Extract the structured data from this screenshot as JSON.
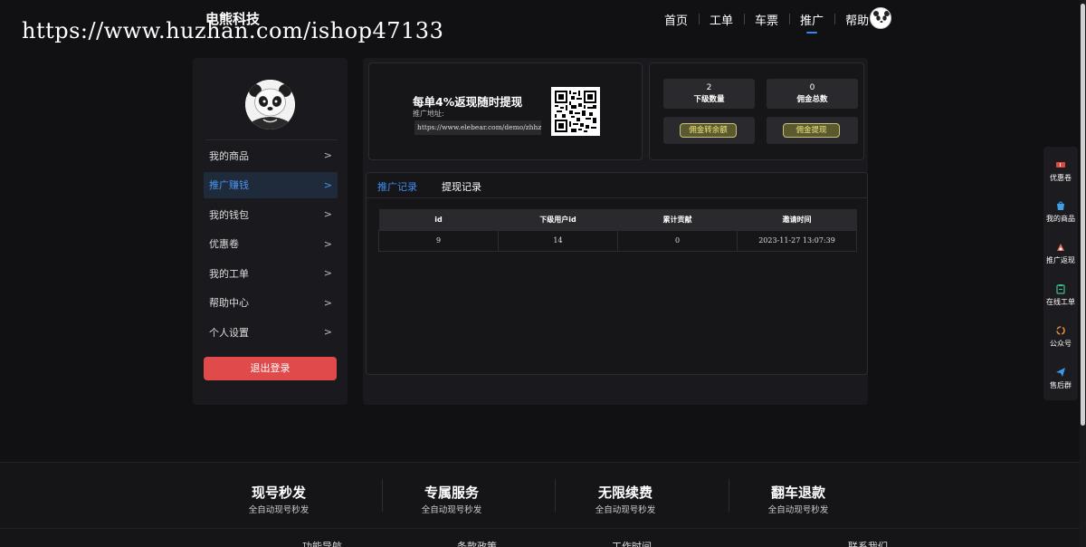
{
  "header": {
    "brand": "电熊科技",
    "watermark_url": "https://www.huzhan.com/ishop47133",
    "nav": [
      "首页",
      "工单",
      "车票",
      "推广",
      "帮助"
    ],
    "active_nav": "推广"
  },
  "sidebar": {
    "items": [
      {
        "label": "我的商品",
        "arrow": ">"
      },
      {
        "label": "推广赚钱",
        "arrow": ">"
      },
      {
        "label": "我的钱包",
        "arrow": ">"
      },
      {
        "label": "优惠卷",
        "arrow": ">"
      },
      {
        "label": "我的工单",
        "arrow": ">"
      },
      {
        "label": "帮助中心",
        "arrow": ">"
      },
      {
        "label": "个人设置",
        "arrow": ">"
      }
    ],
    "active_item": "推广赚钱",
    "logout_label": "退出登录"
  },
  "promo": {
    "title": "每单4%返现随时提现",
    "address_label": "推广地址:",
    "url": "https://www.elebear.com/demo/zhhz?uid=1"
  },
  "stats": {
    "downline_count": "2",
    "downline_label": "下级数量",
    "commission_total": "0",
    "commission_label": "佣金总数",
    "to_balance_button": "佣金转余额",
    "withdraw_button": "佣金提现"
  },
  "records": {
    "tabs": [
      "推广记录",
      "提现记录"
    ],
    "active_tab": "推广记录",
    "columns": [
      "id",
      "下级用户id",
      "累计贡献",
      "邀请时间"
    ],
    "rows": [
      [
        "9",
        "14",
        "0",
        "2023-11-27 13:07:39"
      ]
    ]
  },
  "float_sidebar": {
    "items": [
      {
        "label": "优惠卷",
        "icon": "coupon-icon",
        "color": "#e0473f"
      },
      {
        "label": "我的商品",
        "icon": "bag-icon",
        "color": "#3fa0e8"
      },
      {
        "label": "推广返现",
        "icon": "share-icon",
        "color": "#e06a5a"
      },
      {
        "label": "在线工单",
        "icon": "clipboard-icon",
        "color": "#3dbf8a"
      },
      {
        "label": "公众号",
        "icon": "wechat-icon",
        "color": "#e08a3a"
      },
      {
        "label": "售后群",
        "icon": "send-icon",
        "color": "#3a9ae8"
      }
    ]
  },
  "footer": {
    "features": [
      {
        "title": "现号秒发",
        "subtitle": "全自动现号秒发"
      },
      {
        "title": "专属服务",
        "subtitle": "全自动现号秒发"
      },
      {
        "title": "无限续费",
        "subtitle": "全自动现号秒发"
      },
      {
        "title": "翻车退款",
        "subtitle": "全自动现号秒发"
      }
    ],
    "links": [
      "功能导航",
      "条款政策",
      "工作时间",
      "联系我们"
    ]
  },
  "colors": {
    "accent": "#2f86f6",
    "logout": "#e04a4a",
    "gold_button": "#c9c27a"
  }
}
